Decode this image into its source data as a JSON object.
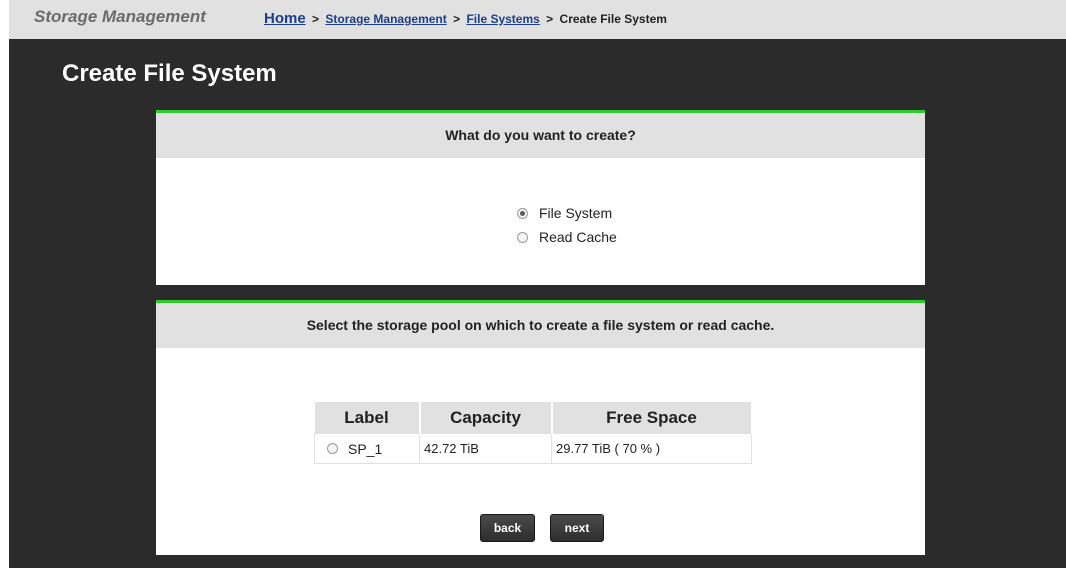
{
  "header": {
    "brand": "Storage Management",
    "breadcrumb": {
      "home": "Home",
      "storage_management": "Storage Management",
      "file_systems": "File Systems",
      "current": "Create File System",
      "separator": ">"
    }
  },
  "page_title": "Create File System",
  "create_panel": {
    "heading": "What do you want to create?",
    "options": [
      {
        "label": "File System",
        "checked": true
      },
      {
        "label": "Read Cache",
        "checked": false
      }
    ]
  },
  "pool_panel": {
    "heading": "Select the storage pool on which to create a file system or read cache.",
    "columns": [
      "Label",
      "Capacity",
      "Free Space"
    ],
    "rows": [
      {
        "label": "SP_1",
        "capacity": "42.72 TiB",
        "free_space": "29.77 TiB ( 70 % )",
        "selected": false
      }
    ],
    "back_label": "back",
    "next_label": "next"
  }
}
